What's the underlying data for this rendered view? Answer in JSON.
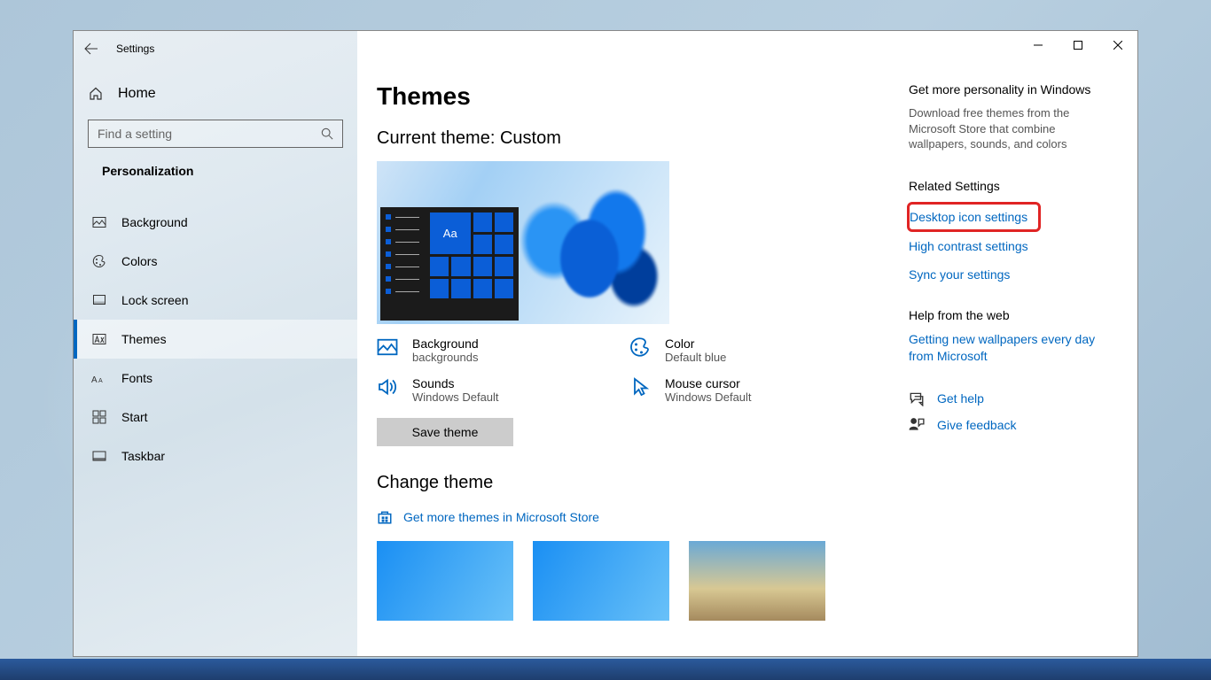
{
  "window": {
    "app_title": "Settings",
    "minimize_tooltip": "Minimize",
    "maximize_tooltip": "Maximize",
    "close_tooltip": "Close"
  },
  "sidebar": {
    "home_label": "Home",
    "search_placeholder": "Find a setting",
    "category": "Personalization",
    "items": [
      {
        "label": "Background",
        "icon": "picture-icon"
      },
      {
        "label": "Colors",
        "icon": "palette-icon"
      },
      {
        "label": "Lock screen",
        "icon": "lockscreen-icon"
      },
      {
        "label": "Themes",
        "icon": "themes-icon",
        "active": true
      },
      {
        "label": "Fonts",
        "icon": "fonts-icon"
      },
      {
        "label": "Start",
        "icon": "start-icon"
      },
      {
        "label": "Taskbar",
        "icon": "taskbar-icon"
      }
    ]
  },
  "main": {
    "title": "Themes",
    "current_theme_heading": "Current theme: Custom",
    "preview_tile_text": "Aa",
    "parts": {
      "background": {
        "label": "Background",
        "value": "backgrounds"
      },
      "color": {
        "label": "Color",
        "value": "Default blue"
      },
      "sounds": {
        "label": "Sounds",
        "value": "Windows Default"
      },
      "cursor": {
        "label": "Mouse cursor",
        "value": "Windows Default"
      }
    },
    "save_button": "Save theme",
    "change_heading": "Change theme",
    "store_link": "Get more themes in Microsoft Store"
  },
  "right": {
    "promo_heading": "Get more personality in Windows",
    "promo_body": "Download free themes from the Microsoft Store that combine wallpapers, sounds, and colors",
    "related_heading": "Related Settings",
    "related_links": [
      "Desktop icon settings",
      "High contrast settings",
      "Sync your settings"
    ],
    "help_heading": "Help from the web",
    "help_link": "Getting new wallpapers every day from Microsoft",
    "get_help": "Get help",
    "give_feedback": "Give feedback"
  }
}
